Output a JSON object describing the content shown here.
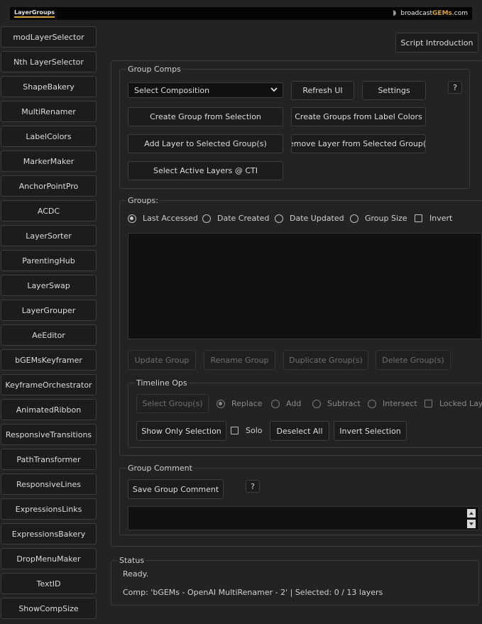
{
  "header": {
    "logo_left": "LayerGroups",
    "logo_right_prefix": "broadcast",
    "logo_right_brand": "GEMs",
    "logo_right_suffix": ".com"
  },
  "sidebar": {
    "items": [
      "modLayerSelector",
      "Nth LayerSelector",
      "ShapeBakery",
      "MultiRenamer",
      "LabelColors",
      "MarkerMaker",
      "AnchorPointPro",
      "ACDC",
      "LayerSorter",
      "ParentingHub",
      "LayerSwap",
      "LayerGrouper",
      "AeEditor",
      "bGEMsKeyframer",
      "KeyframeOrchestrator",
      "AnimatedRibbon",
      "ResponsiveTransitions",
      "PathTransformer",
      "ResponsiveLines",
      "ExpressionsLinks",
      "ExpressionsBakery",
      "DropMenuMaker",
      "TextID",
      "ShowCompSize"
    ]
  },
  "script_intro_label": "Script Introduction",
  "group_comps": {
    "title": "Group Comps",
    "select_value": "Select Composition",
    "refresh_label": "Refresh UI",
    "settings_label": "Settings",
    "help_label": "?",
    "create_group_label": "Create Group from Selection",
    "create_groups_label_colors": "Create Groups from Label Colors",
    "add_layer_label": "Add Layer to Selected Group(s)",
    "remove_layer_label": "Remove Layer from Selected Group(s)",
    "select_active_label": "Select Active Layers @ CTI"
  },
  "groups": {
    "title": "Groups:",
    "sort_options": [
      "Last Accessed",
      "Date Created",
      "Date Updated",
      "Group Size"
    ],
    "sort_selected": "Last Accessed",
    "invert_label": "Invert",
    "update_label": "Update Group",
    "rename_label": "Rename Group",
    "duplicate_label": "Duplicate Group(s)",
    "delete_label": "Delete Group(s)"
  },
  "timeline_ops": {
    "title": "Timeline Ops",
    "select_groups_label": "Select Group(s)",
    "modes": [
      "Replace",
      "Add",
      "Subtract",
      "Intersect"
    ],
    "mode_selected": "Replace",
    "locked_label": "Locked Lay",
    "show_only_label": "Show Only Selection",
    "solo_label": "Solo",
    "deselect_all_label": "Deselect All",
    "invert_selection_label": "Invert Selection"
  },
  "group_comment": {
    "title": "Group Comment",
    "save_label": "Save Group Comment",
    "help_label": "?"
  },
  "status": {
    "title": "Status",
    "line1": "Ready.",
    "line2": "Comp: 'bGEMs - OpenAI MultiRenamer - 2' | Selected: 0 / 13 layers"
  },
  "colors": {
    "background": "#232323",
    "button": "#1c1c1c",
    "brand_accent": "#d8a23a"
  }
}
